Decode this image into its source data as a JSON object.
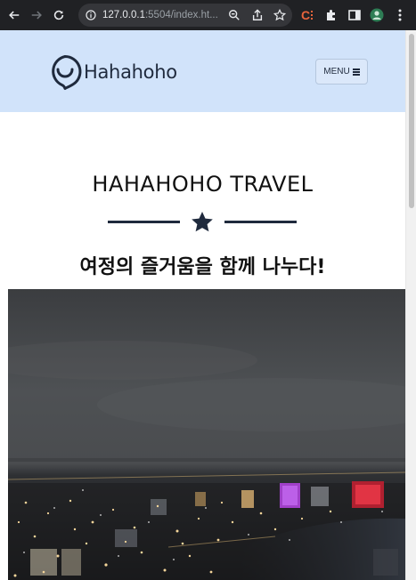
{
  "browser": {
    "url_host": "127.0.0.1",
    "url_rest": ":5504/index.ht...",
    "accent_color": "#e8eaed"
  },
  "header": {
    "brand": "Hahahoho",
    "menu_label": "MENU",
    "background": "#d1e3fa"
  },
  "hero": {
    "title": "HAHAHOHO TRAVEL",
    "subtitle": "여정의 즐거움을 함께 나누다!",
    "divider_icon": "star-icon"
  },
  "photo": {
    "alt_icon": "city-night-photo"
  }
}
